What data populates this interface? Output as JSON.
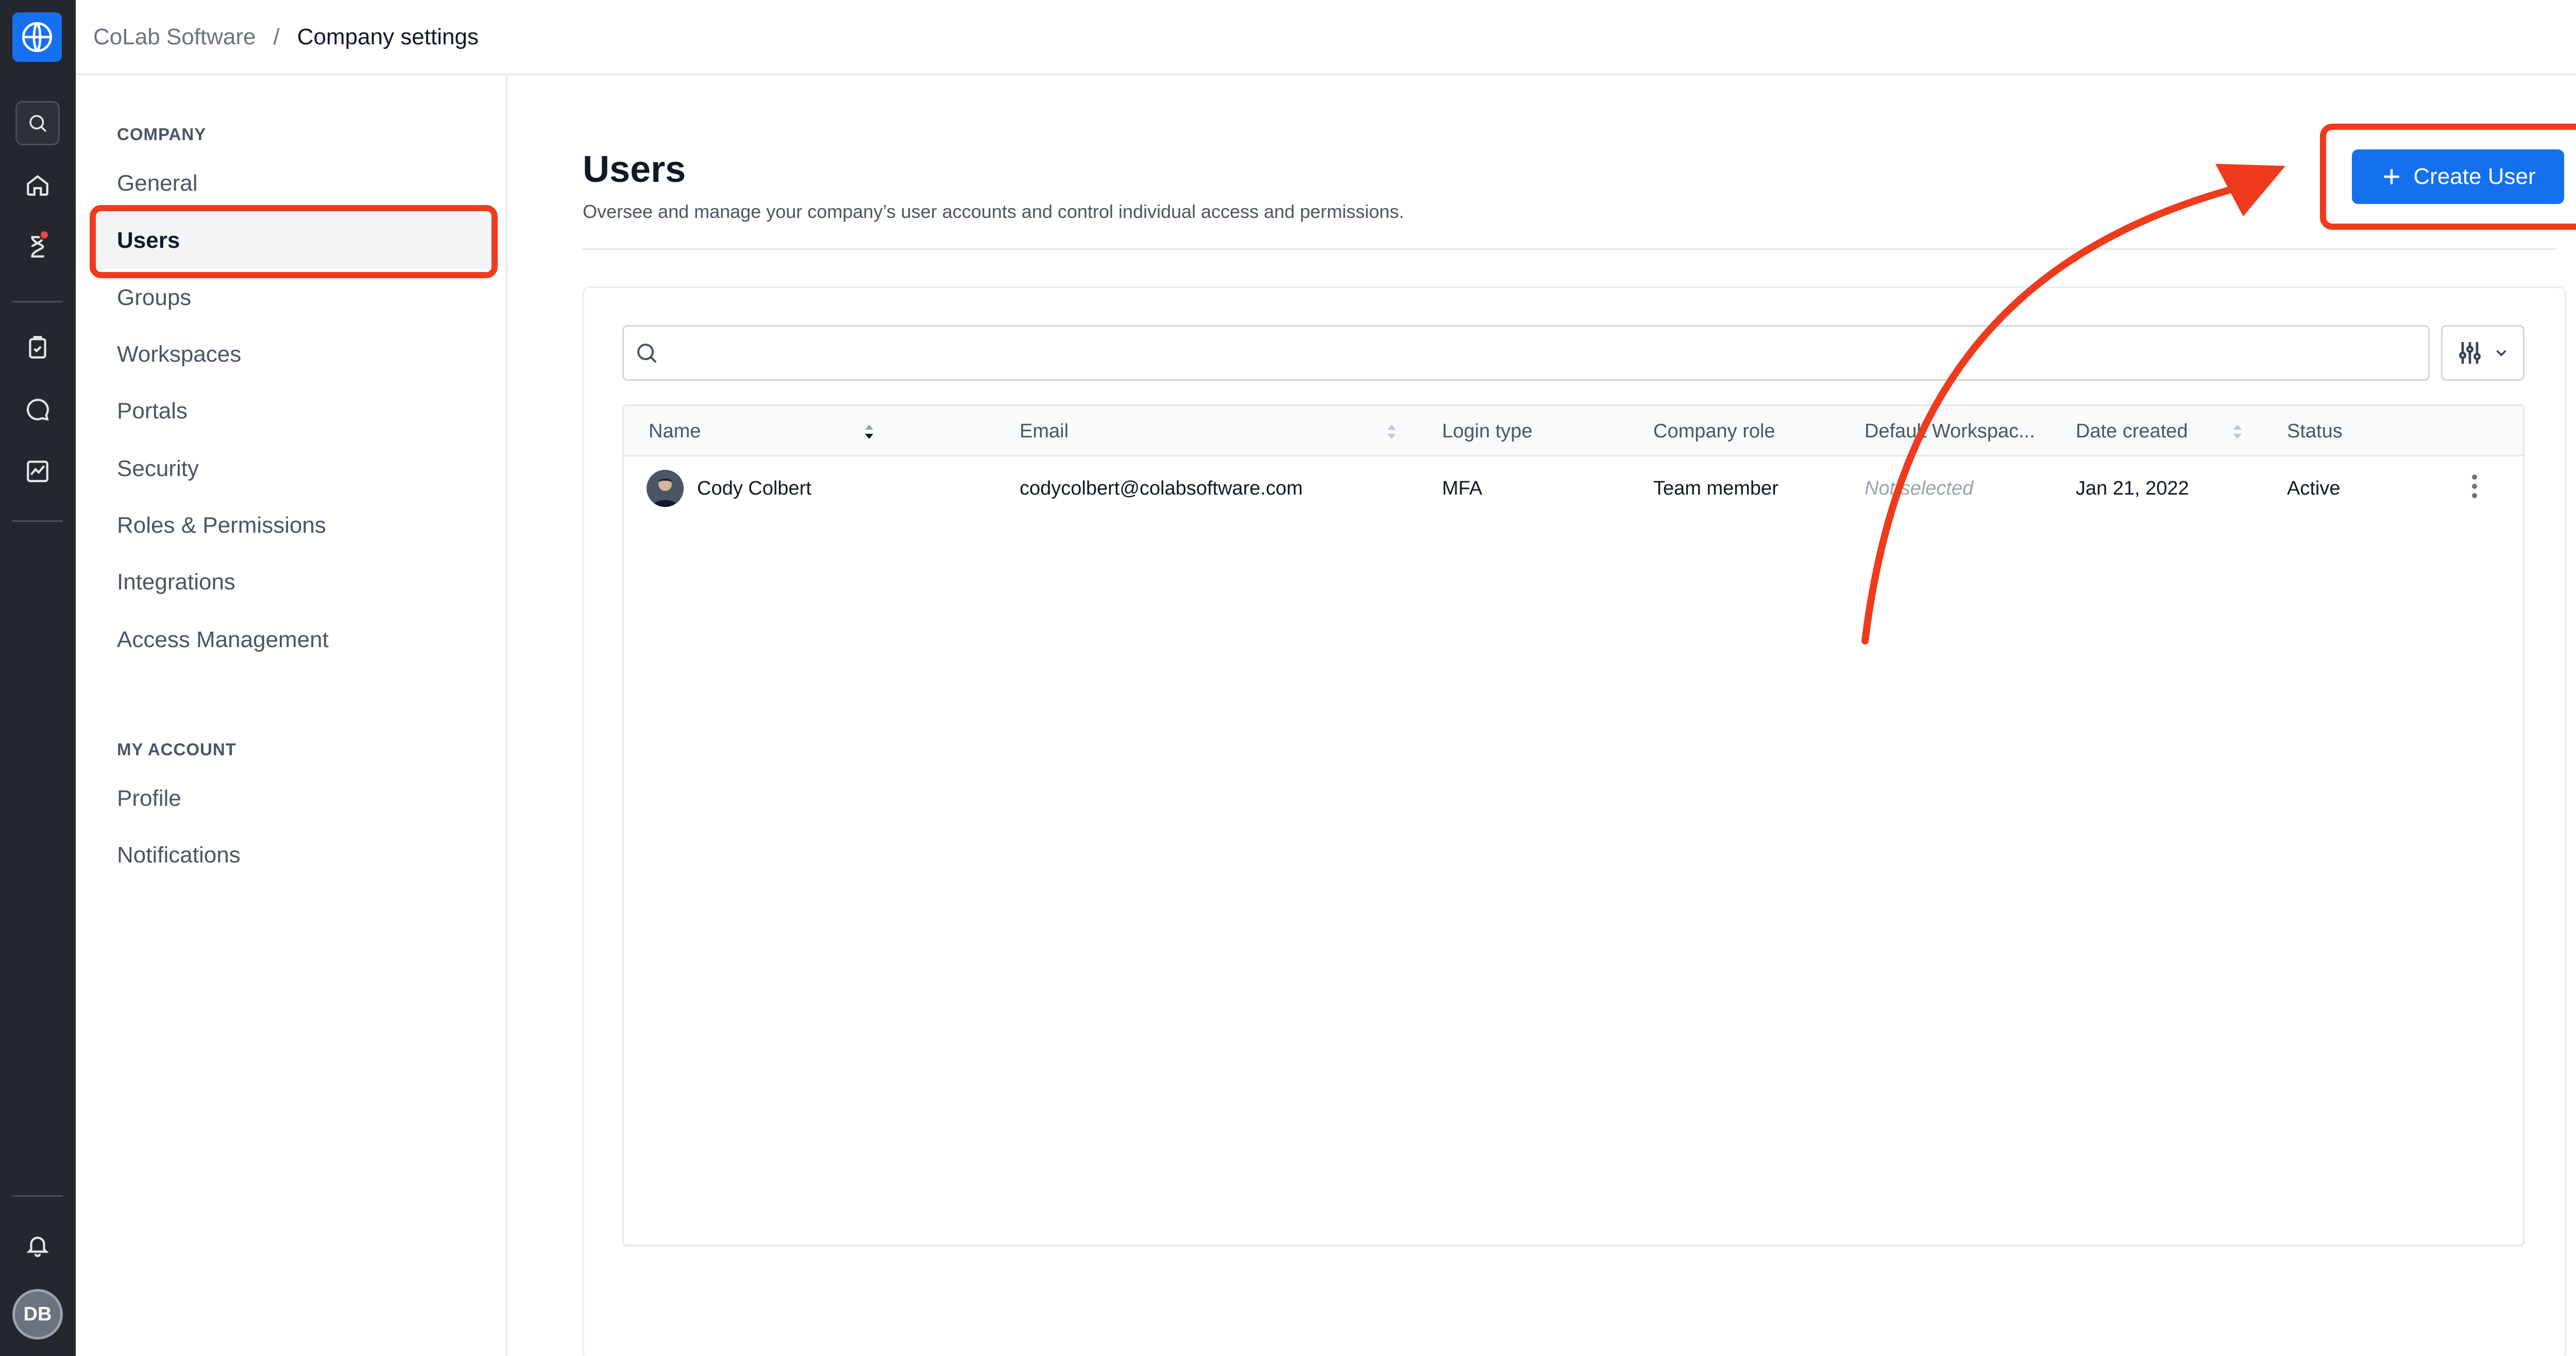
{
  "breadcrumb": {
    "org": "CoLab Software",
    "separator": "/",
    "current": "Company settings"
  },
  "sidebar": {
    "company_heading": "COMPANY",
    "company_items": [
      {
        "label": "General"
      },
      {
        "label": "Users",
        "active": true
      },
      {
        "label": "Groups"
      },
      {
        "label": "Workspaces"
      },
      {
        "label": "Portals"
      },
      {
        "label": "Security"
      },
      {
        "label": "Roles & Permissions"
      },
      {
        "label": "Integrations"
      },
      {
        "label": "Access Management"
      }
    ],
    "account_heading": "MY ACCOUNT",
    "account_items": [
      {
        "label": "Profile"
      },
      {
        "label": "Notifications"
      }
    ]
  },
  "rail": {
    "icons": [
      "globe-icon",
      "search-icon",
      "home-icon",
      "hourglass-icon",
      "clipboard-check-icon",
      "chat-icon",
      "chart-icon",
      "bell-icon"
    ],
    "user_initials": "DB"
  },
  "page": {
    "title": "Users",
    "description": "Oversee and manage your company’s user accounts and control individual access and permissions.",
    "create_button": "Create User"
  },
  "search": {
    "placeholder": "",
    "value": ""
  },
  "table": {
    "columns": {
      "name": "Name",
      "email": "Email",
      "login_type": "Login type",
      "company_role": "Company role",
      "default_workspace": "Default Workspac...",
      "date_created": "Date created",
      "status": "Status"
    },
    "rows": [
      {
        "name": "Cody Colbert",
        "email": "codycolbert@colabsoftware.com",
        "login_type": "MFA",
        "company_role": "Team member",
        "default_workspace": "Not selected",
        "date_created": "Jan 21, 2022",
        "status": "Active"
      }
    ]
  },
  "colors": {
    "accent": "#1570ef",
    "rail_bg": "#24272d",
    "annotation": "#ef3a1d",
    "notification_dot": "#ef4444"
  }
}
